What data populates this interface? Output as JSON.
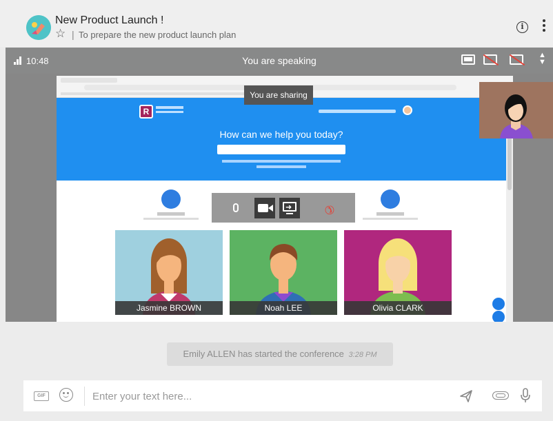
{
  "conversation": {
    "title": "New Product Launch !",
    "separator": "|",
    "topic": "To prepare the new product launch plan"
  },
  "call": {
    "time": "10:48",
    "status": "You are speaking",
    "sharing_label": "You are sharing"
  },
  "shared_screen": {
    "hero_title": "How can we help you today?"
  },
  "participants": [
    {
      "name": "Jasmine BROWN",
      "background": "#9fd0df"
    },
    {
      "name": "Noah LEE",
      "background": "#5cb362"
    },
    {
      "name": "Olivia CLARK",
      "background": "#b0277e"
    }
  ],
  "system_message": {
    "text": "Emily ALLEN has started the conference",
    "time": "3:28 PM"
  },
  "composer": {
    "placeholder": "Enter your text here...",
    "gif_label": "GIF"
  },
  "icons": {
    "header": [
      "star-icon",
      "info-icon",
      "more-vertical-icon"
    ],
    "callbar": [
      "signal-icon",
      "screen-layout-icon",
      "screen-off-icon",
      "screen-share-off-icon",
      "chevron-updown-icon"
    ],
    "toolbar": [
      "microphone-icon",
      "video-camera-icon",
      "share-screen-icon",
      "hang-up-icon"
    ],
    "composer": [
      "gif-icon",
      "emoji-icon",
      "send-icon",
      "attachment-icon",
      "microphone-icon"
    ]
  },
  "colors": {
    "callbar": "#888989",
    "hangup": "#e0453b",
    "brand_blue": "#1f8ff0"
  }
}
